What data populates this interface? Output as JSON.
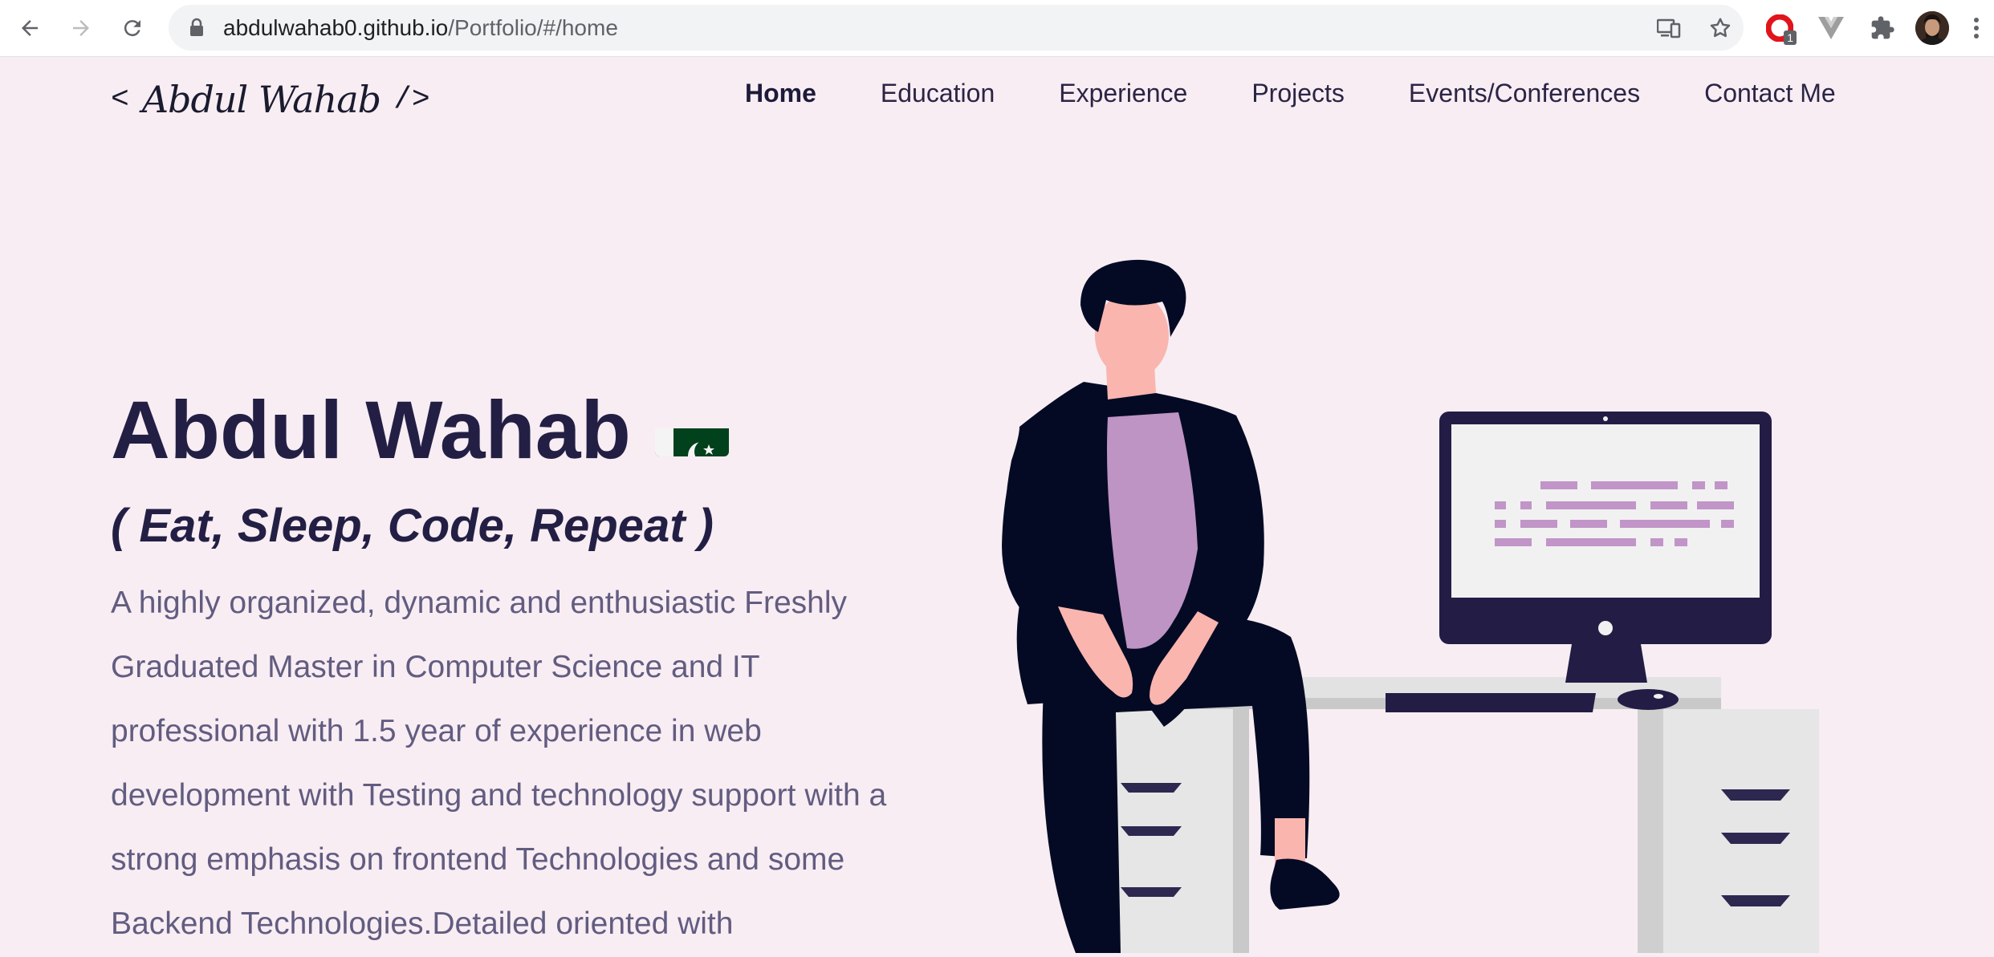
{
  "browser": {
    "url_host": "abdulwahab0.github.io",
    "url_path": "/Portfolio/#/home",
    "extension_badge": "1",
    "icons": [
      "back-arrow-icon",
      "forward-arrow-icon",
      "reload-icon",
      "lock-icon",
      "cast-icon",
      "star-icon",
      "opera-extension-icon",
      "vue-devtools-icon",
      "puzzle-extensions-icon",
      "profile-avatar",
      "kebab-menu-icon"
    ]
  },
  "site": {
    "logo": {
      "open": "<",
      "script": "Abdul Wahab",
      "close": "/>"
    },
    "nav": [
      {
        "label": "Home",
        "active": true
      },
      {
        "label": "Education",
        "active": false
      },
      {
        "label": "Experience",
        "active": false
      },
      {
        "label": "Projects",
        "active": false
      },
      {
        "label": "Events/Conferences",
        "active": false
      },
      {
        "label": "Contact Me",
        "active": false
      }
    ]
  },
  "hero": {
    "name": "Abdul Wahab",
    "flag_icon": "pakistan-flag-icon",
    "tagline": "( Eat, Sleep, Code, Repeat )",
    "description": "A highly organized, dynamic and enthusiastic Freshly Graduated Master in Computer Science and IT professional with 1.5 year of experience in web development with Testing and technology support with a strong emphasis on frontend Technologies and some Backend Technologies.Detailed oriented with"
  },
  "colors": {
    "background": "#f7edf3",
    "heading": "#231f44",
    "body_text": "#625c80",
    "accent": "#bf94c7",
    "dark": "#050a24"
  }
}
